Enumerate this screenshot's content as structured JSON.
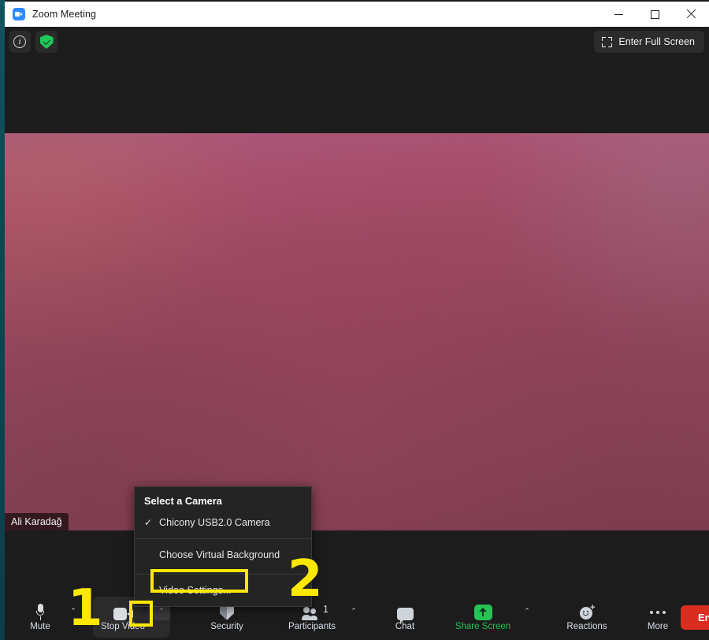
{
  "window": {
    "title": "Zoom Meeting",
    "app_icon": "zoom-camera-icon",
    "minimize_label": "Minimize",
    "maximize_label": "Maximize",
    "close_label": "Close"
  },
  "topbar": {
    "info_icon": "info-icon",
    "info_label": "i",
    "security_shield_icon": "green-shield-check-icon",
    "fullscreen_label": "Enter Full Screen",
    "fullscreen_icon": "expand-icon"
  },
  "video": {
    "participant_name": "Ali Karadağ",
    "dominant_color": "#96465d",
    "top_color": "#a9577e",
    "bottom_color": "#7e3c4d"
  },
  "camera_menu": {
    "header": "Select a Camera",
    "selected_camera": "Chicony USB2.0 Camera",
    "check_glyph": "✓",
    "virtual_background": "Choose Virtual Background",
    "video_settings": "Video Settings..."
  },
  "toolbar": {
    "mute": {
      "label": "Mute",
      "icon": "microphone-icon",
      "caret": "⌃"
    },
    "stop_video": {
      "label": "Stop Video",
      "icon": "camera-icon",
      "caret": "⌃"
    },
    "security": {
      "label": "Security",
      "icon": "shield-icon"
    },
    "participants": {
      "label": "Participants",
      "icon": "people-icon",
      "count": "1",
      "caret": "⌃"
    },
    "chat": {
      "label": "Chat",
      "icon": "chat-bubble-icon"
    },
    "share_screen": {
      "label": "Share Screen",
      "icon": "share-screen-up-arrow-icon",
      "caret": "⌃",
      "color": "#28c257"
    },
    "reactions": {
      "label": "Reactions",
      "icon": "smiley-plus-icon"
    },
    "more": {
      "label": "More",
      "icon": "ellipsis-icon"
    },
    "end": {
      "label": "End",
      "color": "#d92d20"
    }
  },
  "annotations": {
    "marker_one": "1",
    "marker_two": "2",
    "highlight_color": "#ffe800"
  }
}
